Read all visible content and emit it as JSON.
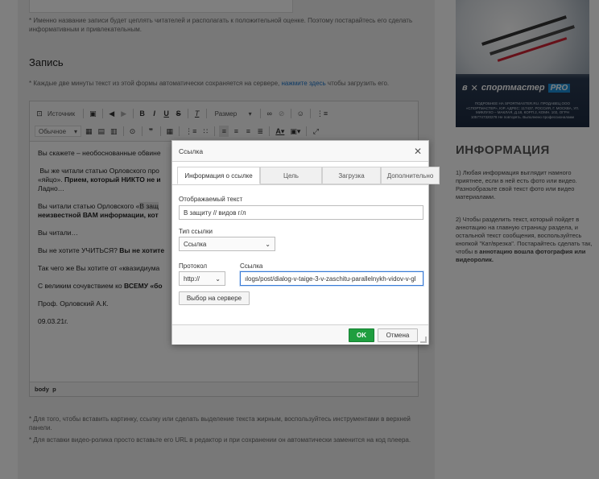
{
  "page": {
    "top_note": "* Именно название записи будет цеплять читателей и располагать к положительной оценке. Поэтому постарайтесь его сделать информативным и привлекательным.",
    "section_title": "Запись",
    "autosave_prefix": "* Каждые две минуты текст из этой формы автоматически сохраняется на сервере,",
    "autosave_link": "нажмите здесь",
    "autosave_suffix": "чтобы загрузить его.",
    "bottom_note1": "* Для того, чтобы вставить картинку, ссылку или сделать выделение текста жирным, воспользуйтесь инструментами в верхней панели.",
    "bottom_note2": "* Для вставки видео-ролика просто вставьте его URL в редактор и при сохранении он автоматически заменится на код плеера."
  },
  "toolbar": {
    "source_label": "Источник",
    "size_label": "Размер",
    "format_label": "Обычное",
    "icons": [
      "source-icon",
      "paste-icon",
      "undo-icon",
      "redo-icon",
      "bold-icon",
      "italic-icon",
      "underline-icon",
      "strike-icon",
      "clear-format-icon",
      "link-icon",
      "unlink-icon",
      "smiley-icon",
      "hr-icon",
      "image-icon",
      "table-icon",
      "quote-icon",
      "list-icon",
      "align-icon",
      "text-color-icon",
      "bg-color-icon",
      "maximize-icon"
    ]
  },
  "editor": {
    "p1": "Вы скажете – необоснованные обвине",
    "p2a": "Вы же читали статью Орловского про",
    "p2b": "«яйцо».",
    "p2c": "Прием, который НИКТО не и",
    "p2d": "Ладно…",
    "p3a": "Вы читали статью Орловского «",
    "p3hl": "В защ",
    "p3b": "неизвестной ВАМ информации, кот",
    "p4": "Вы читали…",
    "p5a": "Вы не хотите УЧИТЬСЯ?",
    "p5b": "Вы не хотите",
    "p6": "Так чего же Вы хотите от «квазидиума",
    "p7a": "С великим сочувствием ко",
    "p7b": "ВСЕМУ «бо",
    "p8": "Проф. Орловский А.К.",
    "p9": "09.03.21г.",
    "status_body": "body",
    "status_p": "p"
  },
  "sidebar": {
    "ad_brand": "спортмастер",
    "ad_pro": "PRO",
    "ad_prefix": "в",
    "ad_fine": "ПОДРОБНЕЕ НА SPORTMASTER.RU. ПРОДАВЕЦ ООО «СПОРТМАСТЕР», ЮР. АДРЕС: 117437, РОССИЯ, Г. МОСКВА, УЛ. МИКЛУХО – МАКЛАЯ, Д.18, КОРП.2, КОМН. 102, ОГРН 1057747320278 Не повторять. Выполнено профессионалами",
    "title": "ИНФОРМАЦИЯ",
    "text1": "1) Любая информация выглядит намного приятнее, если в ней есть фото или видео. Разнообразьте свой текст фото или видео материалами.",
    "text2a": "2) Чтобы разделить текст, который пойдет в аннотацию на главную страницу раздела, и остальной текст сообщения, воспользуйтесь кнопкой \"Кат/врезка\". Постарайтесь сделать так, чтобы в",
    "text2b": "аннотацию вошла фотография или видеоролик."
  },
  "dialog": {
    "title": "Ссылка",
    "tabs": [
      "Информация о ссылке",
      "Цель",
      "Загрузка",
      "Дополнительно"
    ],
    "display_text_label": "Отображаемый текст",
    "display_text_value": "В защиту // видов г/л",
    "link_type_label": "Тип ссылки",
    "link_type_value": "Ссылка",
    "protocol_label": "Протокол",
    "protocol_value": "http://",
    "url_label": "Ссылка",
    "url_value": "ılogs/post/dialog-v-taige-3-v-zaschitu-parallelnykh-vidov-v-gl",
    "browse_server_label": "Выбор на сервере",
    "ok_label": "OK",
    "cancel_label": "Отмена"
  },
  "colors": {
    "ok_green": "#1f9e3f",
    "link_blue": "#1a73c8",
    "focus_blue": "#3a7bd5"
  }
}
